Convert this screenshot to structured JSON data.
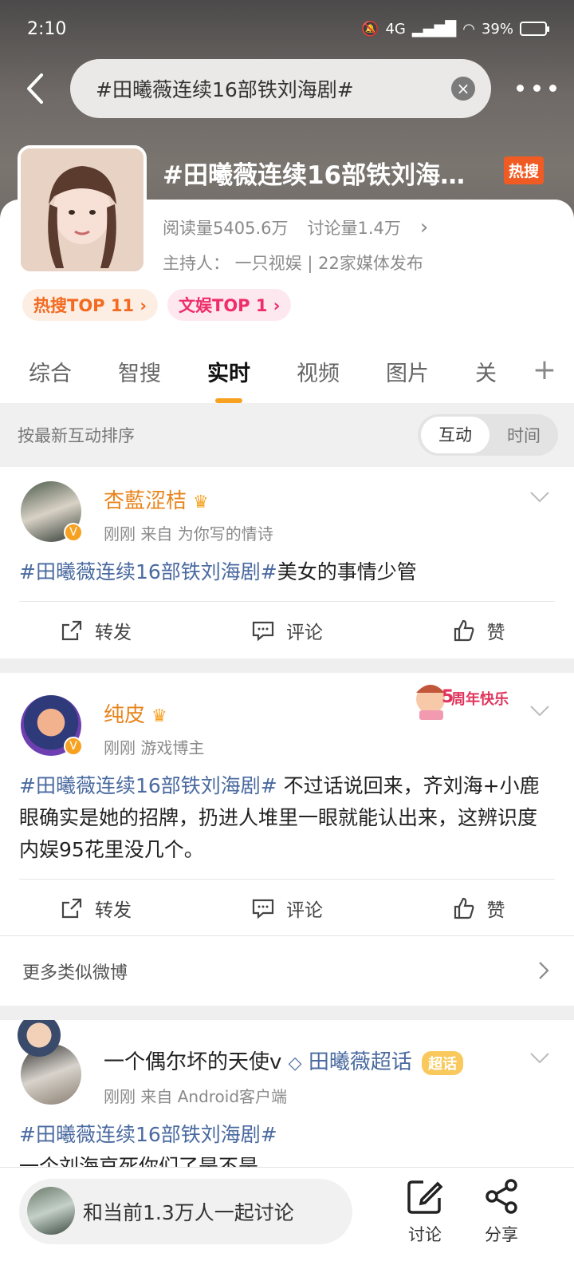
{
  "status_bar": {
    "time": "2:10",
    "network": "4G",
    "battery": "39%"
  },
  "search": {
    "query": "#田曦薇连续16部铁刘海剧#"
  },
  "topic": {
    "title": "#田曦薇连续16部铁刘海…",
    "hot_badge": "热搜",
    "reads": "阅读量5405.6万",
    "discussions": "讨论量1.4万",
    "host": "主持人：  一只视娱 | 22家媒体发布",
    "rank1": "热搜TOP 11 ›",
    "rank2": "文娱TOP 1 ›"
  },
  "tabs": [
    "综合",
    "智搜",
    "实时",
    "视频",
    "图片",
    "关"
  ],
  "sort": {
    "label": "按最新互动排序",
    "opt_interact": "互动",
    "opt_time": "时间"
  },
  "posts": [
    {
      "name": "杏藍涩桔",
      "meta": "刚刚   来自  为你写的情诗",
      "tag": "#田曦薇连续16部铁刘海剧#",
      "text": "美女的事情少管",
      "repost": "转发",
      "comment": "评论",
      "like": "赞"
    },
    {
      "name": "纯皮",
      "meta": "刚刚   游戏博主",
      "tag": "#田曦薇连续16部铁刘海剧#",
      "text": " 不过话说回来，齐刘海+小鹿眼确实是她的招牌，扔进人堆里一眼就能认出来，这辨识度内娱95花里没几个。",
      "badge": "周年快乐",
      "repost": "转发",
      "comment": "评论",
      "like": "赞"
    },
    {
      "name": "一个偶尔坏的天使v",
      "supertopic": "田曦薇超话",
      "super_badge": "超话",
      "meta": "刚刚   来自  Android客户端",
      "tag": "#田曦薇连续16部铁刘海剧#",
      "text": "一个刘海哀死你们了是不是"
    }
  ],
  "more_similar": "更多类似微博",
  "bottom": {
    "join": "和当前1.3万人一起讨论",
    "discuss": "讨论",
    "share": "分享"
  }
}
